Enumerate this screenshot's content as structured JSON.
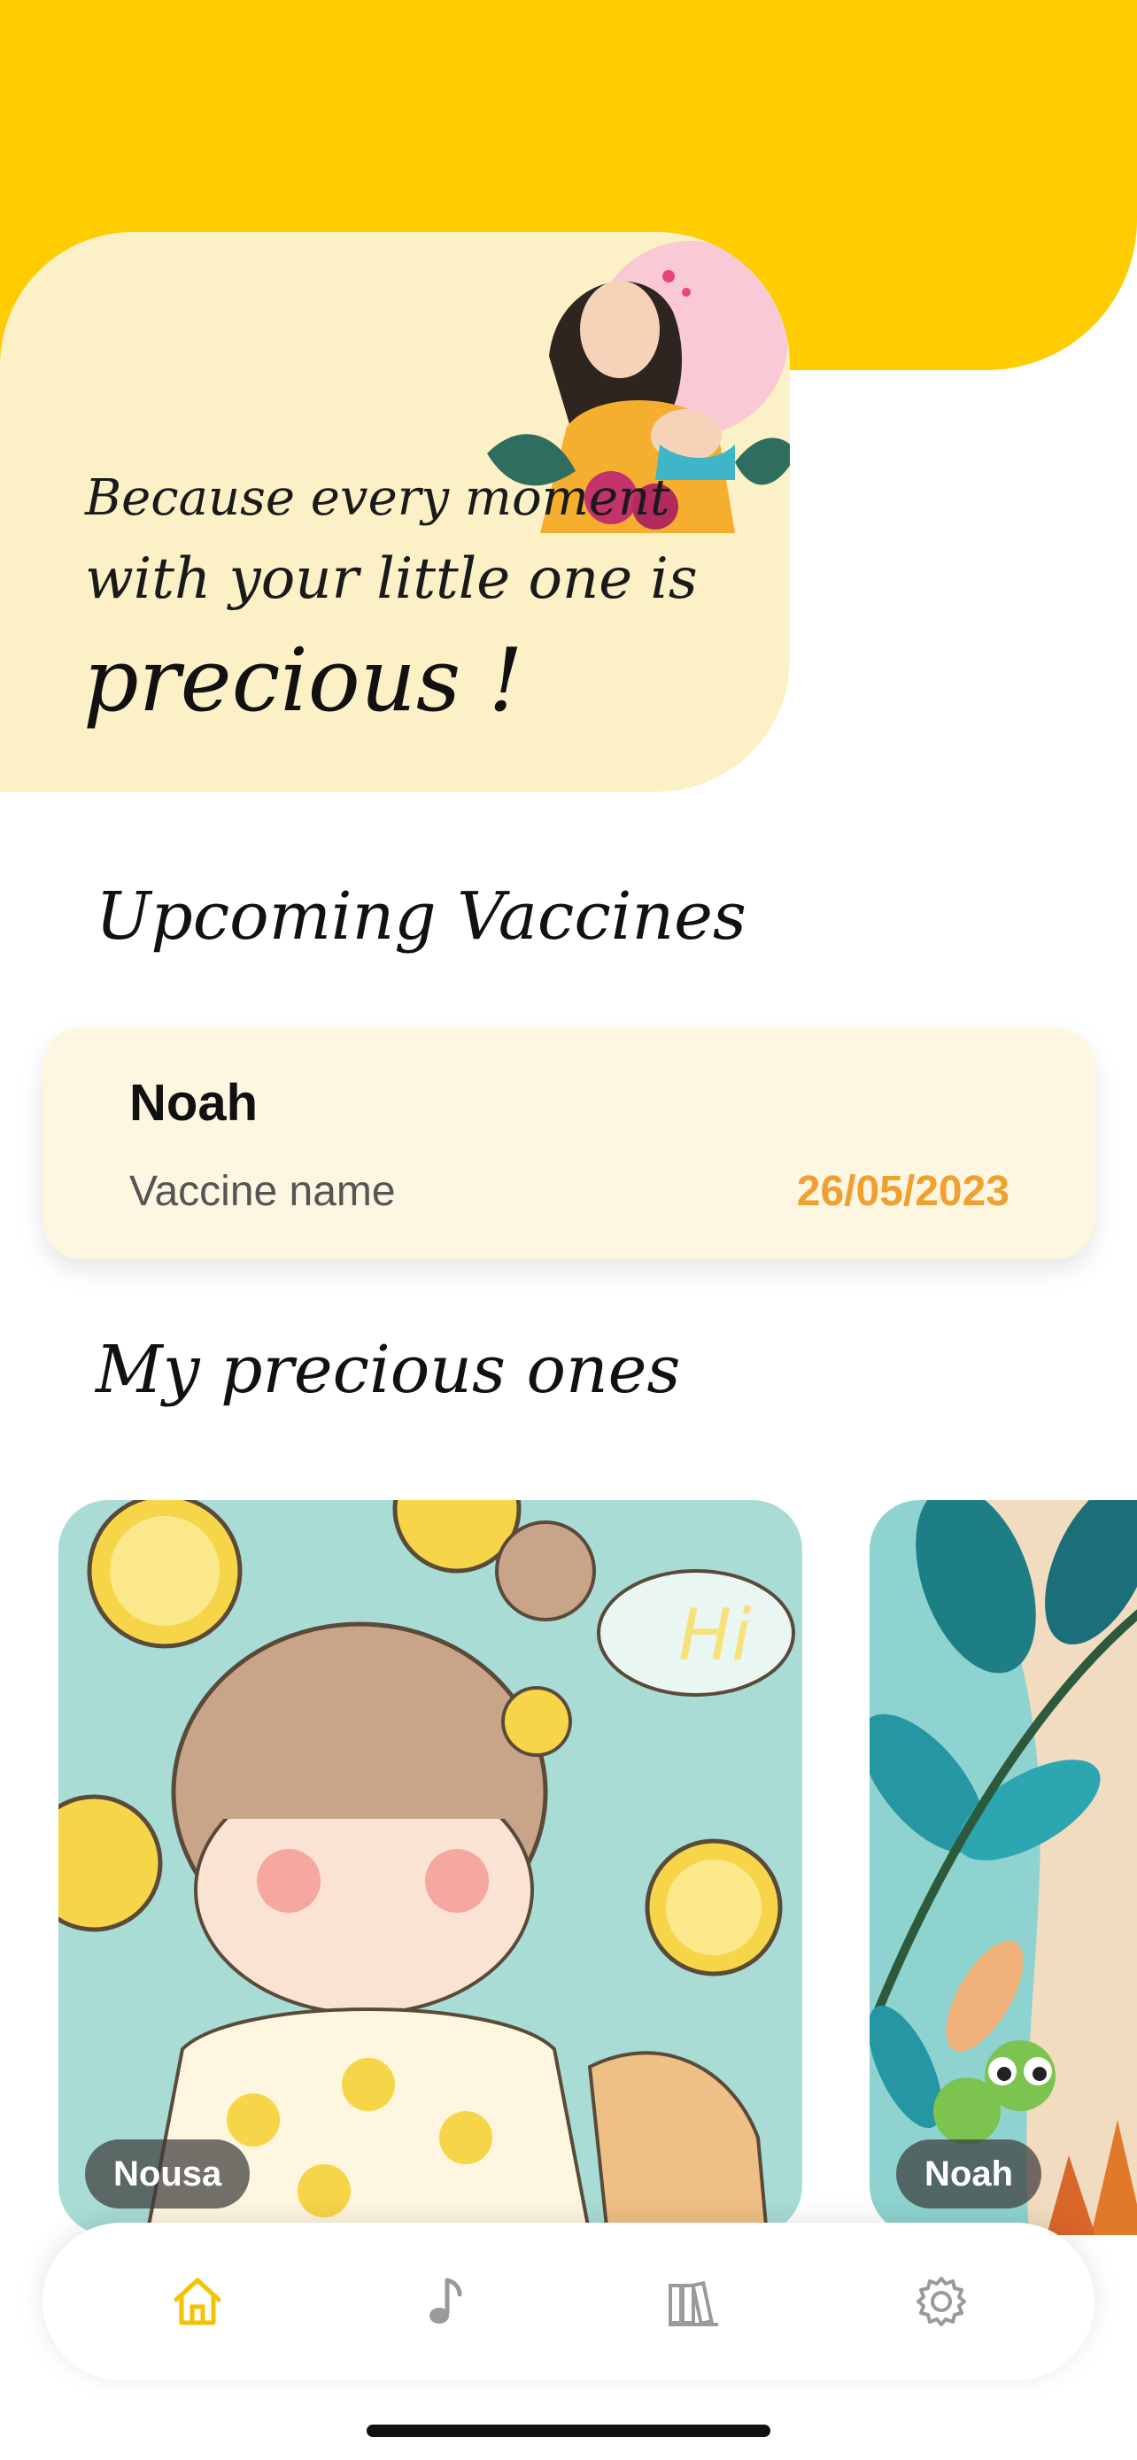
{
  "hero": {
    "line1": "Because every moment",
    "line2": "with your little one is",
    "line3": "precious !"
  },
  "sections": {
    "upcoming_title": "Upcoming Vaccines",
    "ones_title": "My precious ones"
  },
  "vaccine": {
    "child": "Noah",
    "name": "Vaccine name",
    "date": "26/05/2023"
  },
  "children": [
    {
      "name": "Nousa"
    },
    {
      "name": "Noah"
    }
  ],
  "tabbar": {
    "items": [
      "home-icon",
      "music-icon",
      "library-icon",
      "settings-icon"
    ],
    "active_color": "#F5C200",
    "inactive_color": "#9A9A9A"
  },
  "colors": {
    "brand_yellow": "#FFCC00",
    "card_cream": "#FBF0C6",
    "date_orange": "#F0A030"
  }
}
